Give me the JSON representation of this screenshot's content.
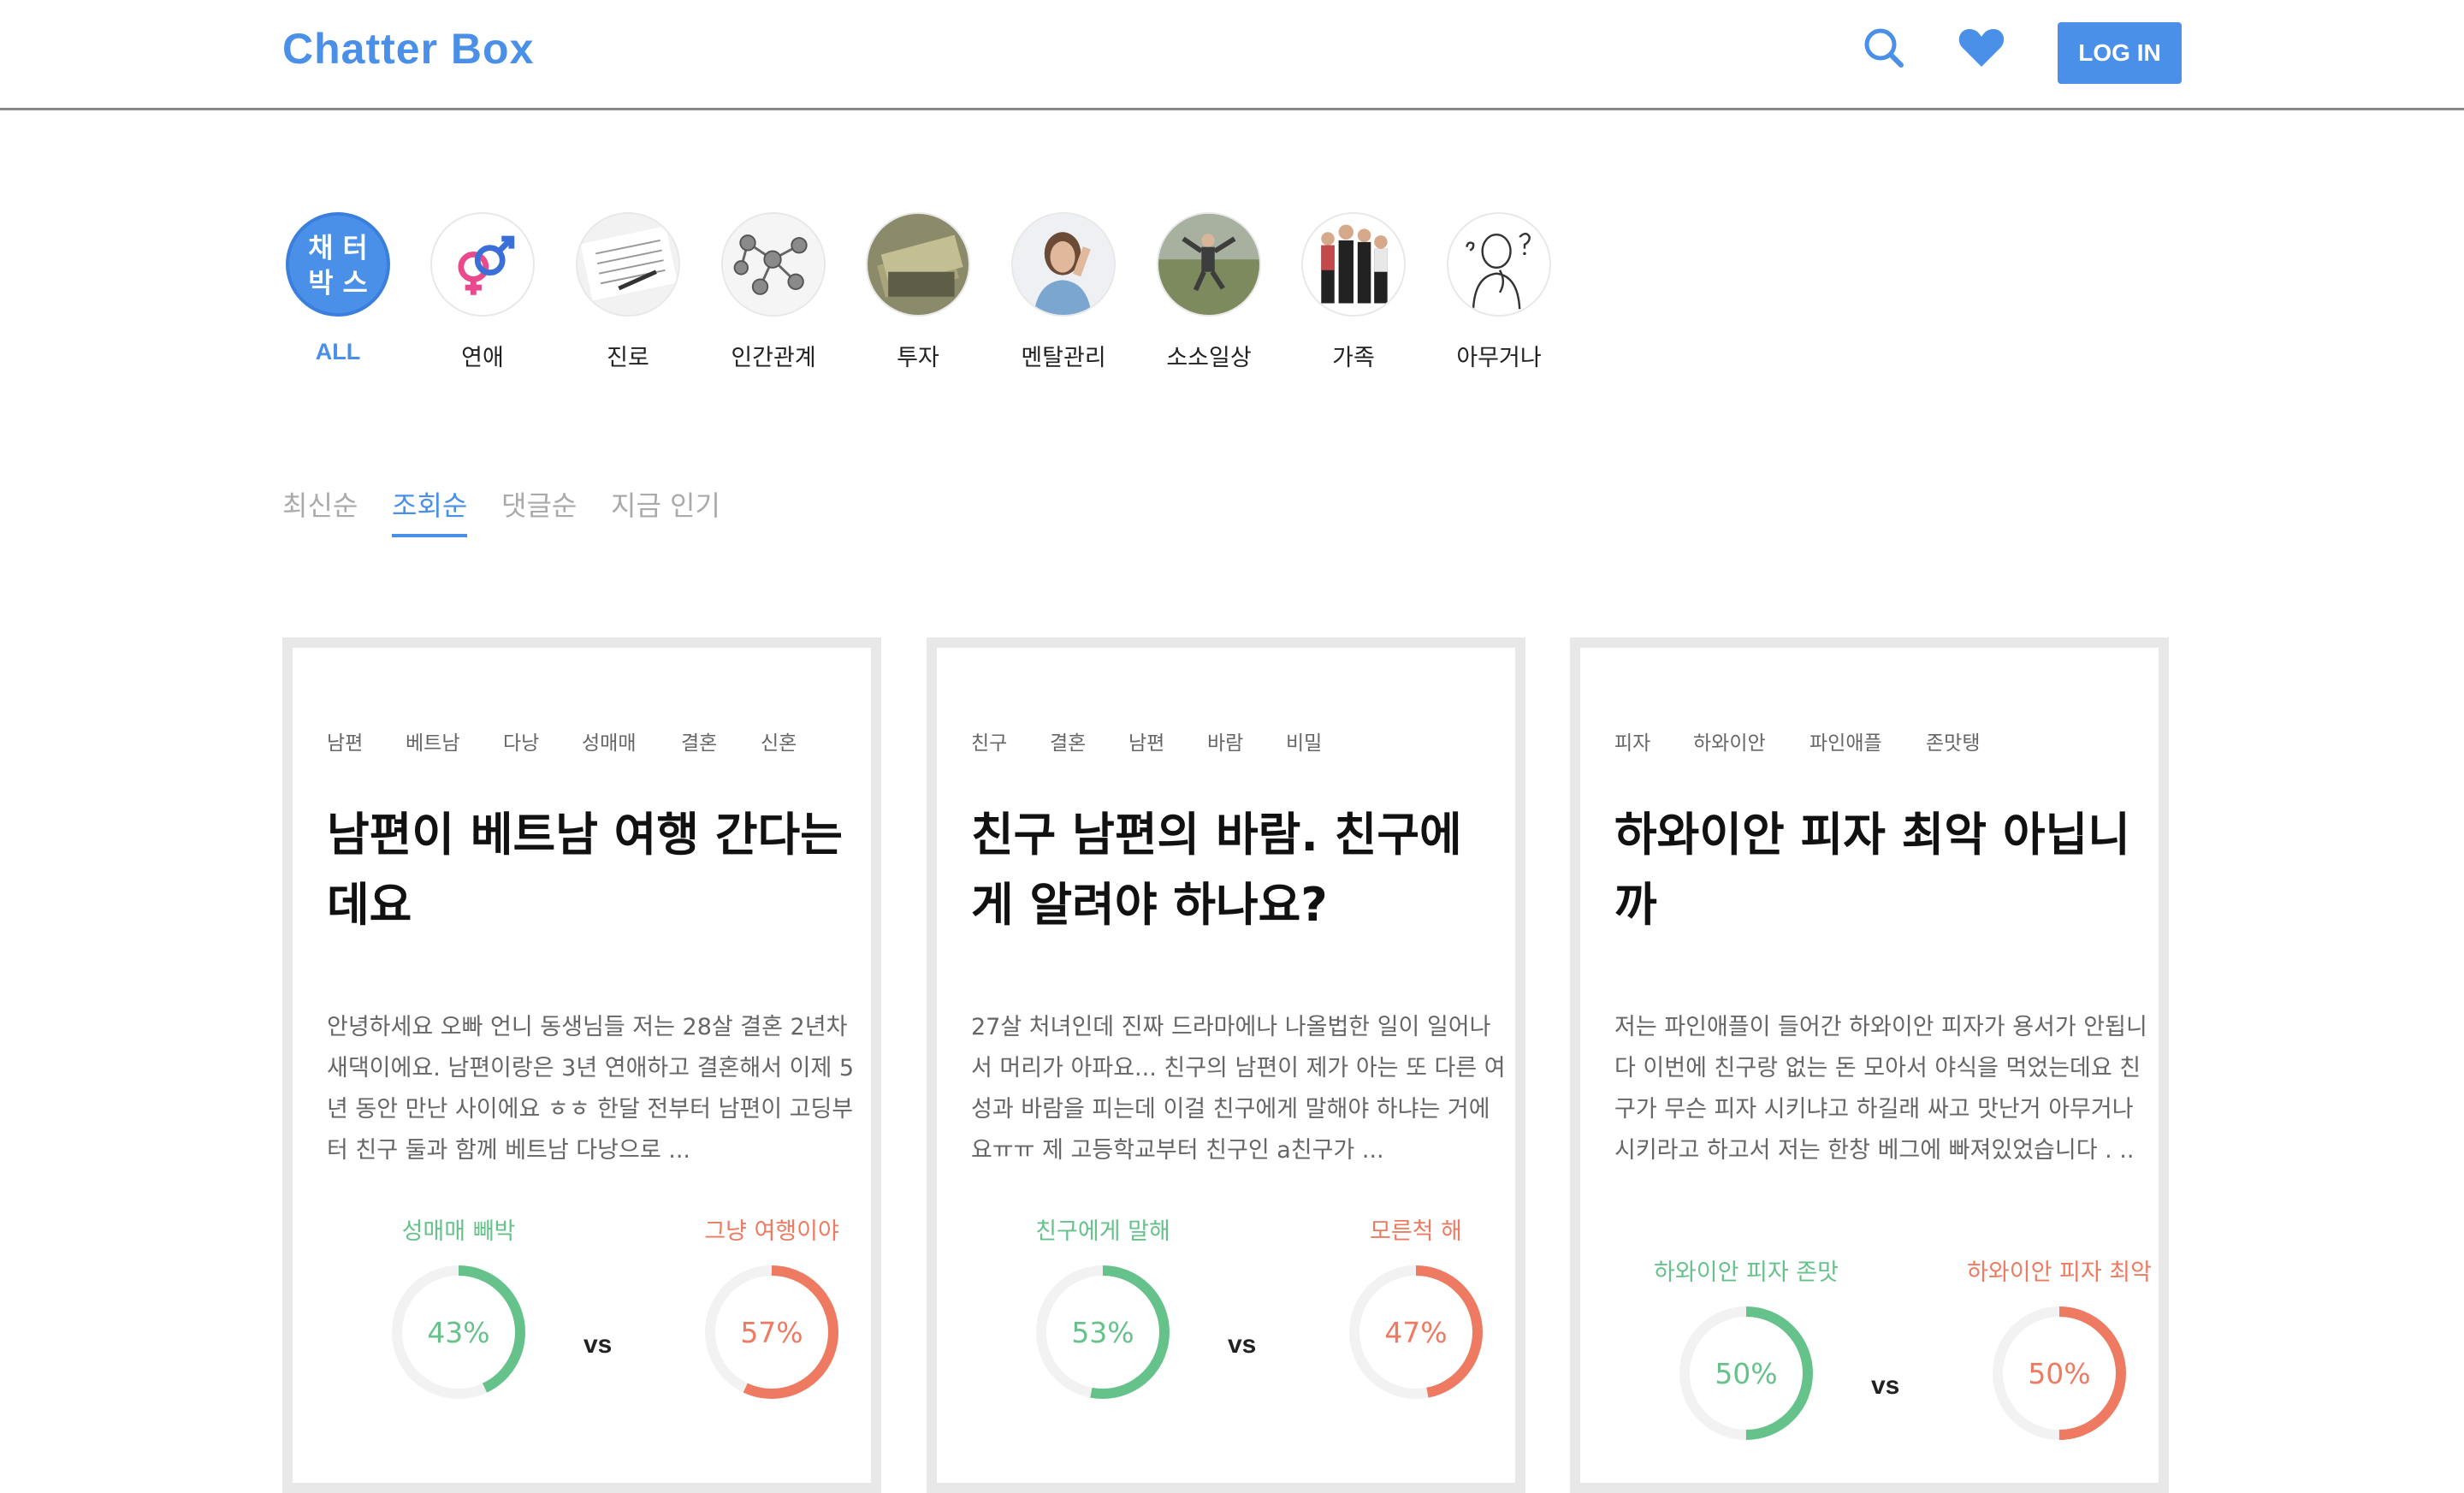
{
  "header": {
    "logo": "Chatter Box",
    "login_label": "LOG IN"
  },
  "categories": [
    {
      "label": "ALL",
      "badge_line1": "채 터",
      "badge_line2": "박 스",
      "active": true
    },
    {
      "label": "연애",
      "icon": "gender-symbols-icon"
    },
    {
      "label": "진로",
      "icon": "employment-application-icon"
    },
    {
      "label": "인간관계",
      "icon": "network-icon"
    },
    {
      "label": "투자",
      "icon": "money-icon"
    },
    {
      "label": "멘탈관리",
      "icon": "stressed-woman-icon"
    },
    {
      "label": "소소일상",
      "icon": "jumping-person-icon"
    },
    {
      "label": "가족",
      "icon": "family-icon"
    },
    {
      "label": "아무거나",
      "icon": "thinking-man-icon"
    }
  ],
  "sort_tabs": [
    "최신순",
    "조회순",
    "댓글순",
    "지금 인기"
  ],
  "active_sort": "조회순",
  "cards": [
    {
      "tags": [
        "남편",
        "베트남",
        "다낭",
        "성매매",
        "결혼",
        "신혼"
      ],
      "title_line1": "남편이 베트남 여행 간다는",
      "title_line2": "데요",
      "body": "안녕하세요 오빠 언니 동생님들 저는 28살 결혼 2년차 새댁이에요. 남편이랑은 3년 연애하고 결혼해서 이제 5년 동안 만난 사이에요 ㅎㅎ 한달 전부터 남편이 고딩부터 친구 둘과 함께 베트남 다낭으로 ...",
      "vs": "vs",
      "left": {
        "label": "성매매 빼박",
        "pct": "43%",
        "value": 43
      },
      "right": {
        "label": "그냥 여행이야",
        "pct": "57%",
        "value": 57
      }
    },
    {
      "tags": [
        "친구",
        "결혼",
        "남편",
        "바람",
        "비밀"
      ],
      "title_line1": "친구 남편의 바람. 친구에",
      "title_line2": "게 알려야 하나요?",
      "body": "27살 처녀인데 진짜 드라마에나 나올법한 일이 일어나서 머리가 아파요... 친구의 남편이 제가 아는 또 다른 여성과 바람을 피는데 이걸 친구에게 말해야 하냐는 거에요ㅠㅠ 제 고등학교부터 친구인 a친구가 ...",
      "vs": "vs",
      "left": {
        "label": "친구에게 말해",
        "pct": "53%",
        "value": 53
      },
      "right": {
        "label": "모른척 해",
        "pct": "47%",
        "value": 47
      }
    },
    {
      "tags": [
        "피자",
        "하와이안",
        "파인애플",
        "존맛탱"
      ],
      "title_line1": "하와이안 피자 최악 아닙니",
      "title_line2": "까",
      "body": "저는 파인애플이 들어간 하와이안 피자가 용서가 안됩니다 이번에 친구랑 없는 돈 모아서 야식을 먹었는데요 친구가 무슨 피자 시키냐고 하길래 싸고 맛난거 아무거나 시키라고 하고서 저는 한창 베그에 빠져있었습니다 . ..",
      "vs": "vs",
      "left": {
        "label": "하와이안 피자 존맛",
        "pct": "50%",
        "value": 50
      },
      "right": {
        "label": "하와이안 피자 최악",
        "pct": "50%",
        "value": 50
      }
    }
  ],
  "colors": {
    "accent": "#4a8fe8",
    "green": "#66c28b",
    "red": "#ee7a62"
  }
}
